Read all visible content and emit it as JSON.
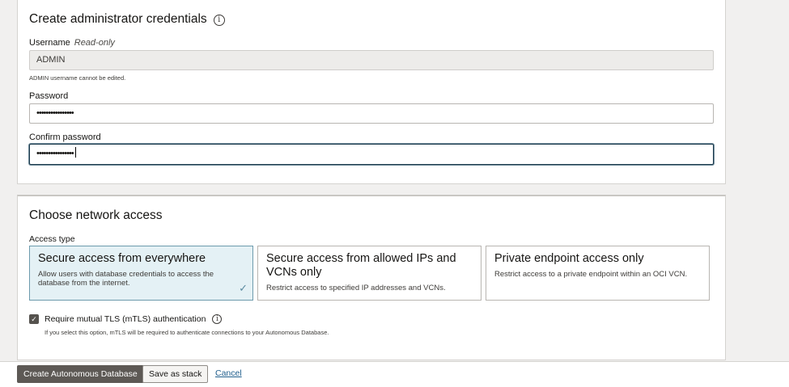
{
  "credentials": {
    "title": "Create administrator credentials",
    "username_label": "Username",
    "readonly_tag": "Read-only",
    "username_value": "ADMIN",
    "username_hint": "ADMIN username cannot be edited.",
    "password_label": "Password",
    "password_value": "••••••••••••••••",
    "confirm_label": "Confirm password",
    "confirm_value": "••••••••••••••••"
  },
  "network": {
    "title": "Choose network access",
    "access_type_label": "Access type",
    "options": [
      {
        "title": "Secure access from everywhere",
        "desc": "Allow users with database credentials to access the database from the internet.",
        "selected": true
      },
      {
        "title": "Secure access from allowed IPs and VCNs only",
        "desc": "Restrict access to specified IP addresses and VCNs.",
        "selected": false
      },
      {
        "title": "Private endpoint access only",
        "desc": "Restrict access to a private endpoint within an OCI VCN.",
        "selected": false
      }
    ],
    "mtls_label": "Require mutual TLS (mTLS) authentication",
    "mtls_checked": true,
    "mtls_hint": "If you select this option, mTLS will be required to authenticate connections to your Autonomous Database."
  },
  "footer": {
    "create_label": "Create Autonomous Database",
    "save_stack_label": "Save as stack",
    "cancel_label": "Cancel"
  },
  "icons": {
    "info": "info-icon",
    "check": "checkmark-icon",
    "checkbox": "checkbox-checked-icon"
  },
  "colors": {
    "primary_button": "#5d5955",
    "selected_card_bg": "#e4f1f5",
    "focus_border": "#1f3d4e",
    "link": "#1f5e8c"
  }
}
